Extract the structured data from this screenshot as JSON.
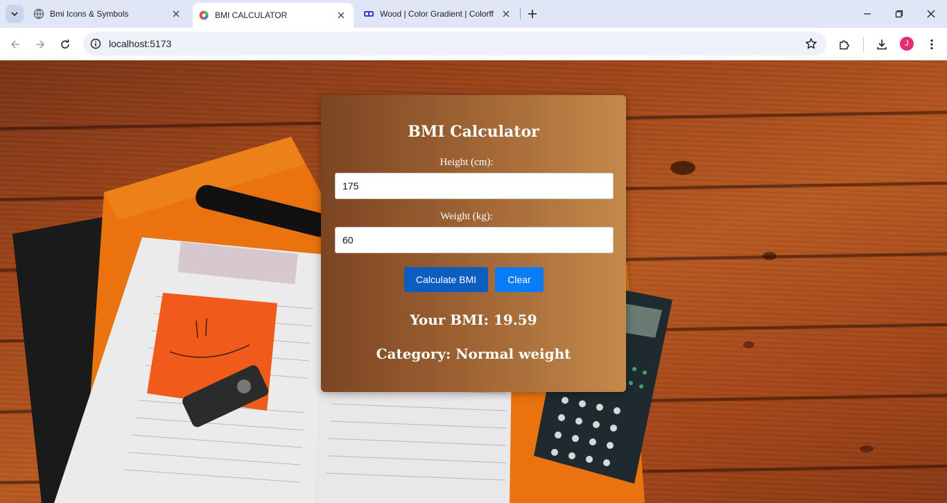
{
  "browser": {
    "tabs": [
      {
        "title": "Bmi Icons & Symbols",
        "active": false,
        "favicon": "globe-icon"
      },
      {
        "title": "BMI CALCULATOR",
        "active": true,
        "favicon": "app-logo-icon"
      },
      {
        "title": "Wood | Color Gradient | Colorff",
        "active": false,
        "favicon": "colorffy-icon"
      }
    ],
    "url": "localhost:5173",
    "profile_initial": "J",
    "colors": {
      "profile": "#e0306f",
      "tabbar": "#dfe6f5"
    }
  },
  "app": {
    "title": "BMI Calculator",
    "height_label": "Height (cm):",
    "height_value": "175",
    "weight_label": "Weight (kg):",
    "weight_value": "60",
    "calculate_label": "Calculate BMI",
    "clear_label": "Clear",
    "result_bmi": "Your BMI: 19.59",
    "result_category": "Category: Normal weight",
    "colors": {
      "calculate_button": "#0a5ec0",
      "clear_button": "#0a7cf5",
      "card_gradient_start": "#7b4522",
      "card_gradient_end": "#c38a4a"
    }
  }
}
